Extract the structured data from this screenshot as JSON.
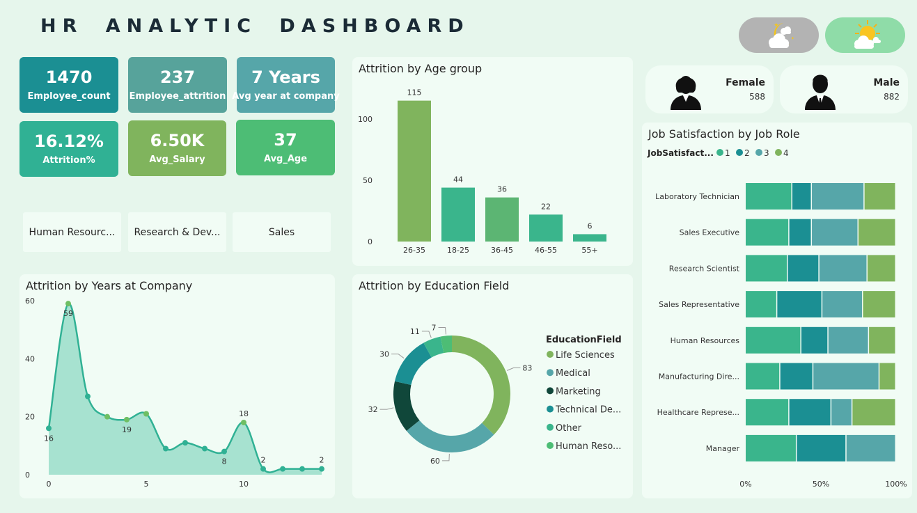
{
  "header": {
    "title": "HR ANALYTIC DASHBOARD"
  },
  "theme": {
    "dark_icon": "moon-cloud-icon",
    "light_icon": "sun-cloud-icon"
  },
  "kpis": [
    {
      "value": "1470",
      "label": "Employee_count",
      "color": "#1b8f93"
    },
    {
      "value": "237",
      "label": "Employee_attrition",
      "color": "#57a39b"
    },
    {
      "value": "7 Years",
      "label": "Avg year at company",
      "color": "#56a6a9"
    },
    {
      "value": "16.12%",
      "label": "Attrition%",
      "color": "#30b194"
    },
    {
      "value": "6.50K",
      "label": "Avg_Salary",
      "color": "#80b45d"
    },
    {
      "value": "37",
      "label": "Avg_Age",
      "color": "#4dbd75"
    }
  ],
  "slicers": [
    "Human Resourc...",
    "Research & Dev...",
    "Sales"
  ],
  "gender": {
    "female": {
      "label": "Female",
      "value": "588",
      "icon": "female-user-icon"
    },
    "male": {
      "label": "Male",
      "value": "882",
      "icon": "male-user-icon"
    }
  },
  "charts": {
    "age": {
      "title": "Attrition by Age group"
    },
    "years": {
      "title": "Attrition by Years at Company"
    },
    "edu": {
      "title": "Attrition by Education Field",
      "legend_title": "EducationField"
    },
    "job": {
      "title": "Job Satisfaction by Job Role",
      "legend_title": "JobSatisfact..."
    }
  },
  "chart_data": [
    {
      "type": "bar",
      "title": "Attrition by Age group",
      "categories": [
        "26-35",
        "18-25",
        "36-45",
        "46-55",
        "55+"
      ],
      "values": [
        115,
        44,
        36,
        22,
        6
      ],
      "colors": [
        "#80b45d",
        "#3ab58c",
        "#5cb573",
        "#3ab58c",
        "#3ab58c"
      ],
      "yticks": [
        0,
        50,
        100
      ],
      "ylim": [
        0,
        125
      ]
    },
    {
      "type": "area",
      "title": "Attrition by Years at Company",
      "x": [
        0,
        1,
        2,
        3,
        4,
        5,
        6,
        7,
        8,
        9,
        10,
        11,
        12,
        13,
        14
      ],
      "y": [
        16,
        59,
        27,
        20,
        19,
        21,
        9,
        11,
        9,
        8,
        18,
        2,
        2,
        2,
        2
      ],
      "labeled_points": [
        {
          "x": 0,
          "label": "16",
          "pos": "below"
        },
        {
          "x": 1,
          "label": "59",
          "pos": "below"
        },
        {
          "x": 4,
          "label": "19",
          "pos": "below"
        },
        {
          "x": 9,
          "label": "8",
          "pos": "below"
        },
        {
          "x": 10,
          "label": "18",
          "pos": "above"
        },
        {
          "x": 11,
          "label": "2",
          "pos": "above"
        },
        {
          "x": 14,
          "label": "2",
          "pos": "above"
        }
      ],
      "xticks": [
        0,
        5,
        10
      ],
      "yticks": [
        0,
        20,
        40,
        60
      ],
      "xlim": [
        0,
        14
      ],
      "ylim": [
        0,
        60
      ]
    },
    {
      "type": "pie",
      "title": "Attrition by Education Field",
      "legend_title": "EducationField",
      "labels": [
        "Life Sciences",
        "Medical",
        "Marketing",
        "Technical De...",
        "Other",
        "Human Reso..."
      ],
      "values": [
        83,
        60,
        32,
        30,
        11,
        7
      ],
      "colors": [
        "#80b45d",
        "#56a6a9",
        "#10473a",
        "#1b8f93",
        "#3ab58c",
        "#4dbd75"
      ]
    },
    {
      "type": "bar",
      "title": "Job Satisfaction by Job Role",
      "legend_title": "JobSatisfact...",
      "stacked": "100%",
      "categories": [
        "Laboratory Technician",
        "Sales Executive",
        "Research Scientist",
        "Sales Representative",
        "Human Resources",
        "Manufacturing Dire...",
        "Healthcare Represe...",
        "Manager"
      ],
      "series": [
        {
          "name": "1",
          "color": "#3ab58c",
          "values": [
            31,
            29,
            28,
            21,
            37,
            23,
            29,
            34
          ]
        },
        {
          "name": "2",
          "color": "#1b8f93",
          "values": [
            13,
            15,
            21,
            30,
            18,
            22,
            28,
            33
          ]
        },
        {
          "name": "3",
          "color": "#56a6a9",
          "values": [
            35,
            31,
            32,
            27,
            27,
            44,
            14,
            33
          ]
        },
        {
          "name": "4",
          "color": "#80b45d",
          "values": [
            21,
            25,
            19,
            22,
            18,
            11,
            29,
            0
          ]
        }
      ],
      "xticks": [
        "0%",
        "50%",
        "100%"
      ]
    }
  ]
}
